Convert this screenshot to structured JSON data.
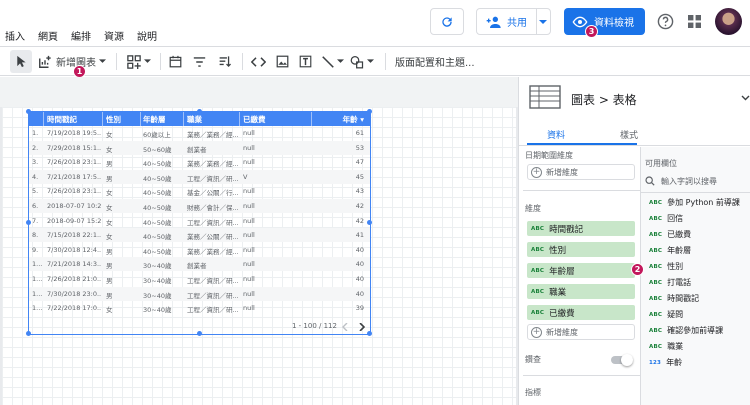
{
  "menu": [
    "插入",
    "網頁",
    "編排",
    "資源",
    "說明"
  ],
  "header": {
    "share_label": "共用",
    "view_label": "資料檢視",
    "view_badge": "3"
  },
  "toolbar": {
    "add_chart_label": "新增圖表",
    "add_chart_badge": "1",
    "theme_label": "版面配置和主題..."
  },
  "table": {
    "headers": [
      "時間戳記",
      "性別",
      "年齡層",
      "職業",
      "已繳費",
      "年齡 ▾"
    ],
    "rows": [
      [
        "1.",
        "7/19/2018 19:5...",
        "女",
        "60歲以上",
        "業務／業務／經...",
        "null",
        "61"
      ],
      [
        "2.",
        "7/29/2018 15:1...",
        "女",
        "50~60歲",
        "創業者",
        "null",
        "53"
      ],
      [
        "3.",
        "7/26/2018 23:1...",
        "男",
        "40~50歲",
        "業務／業務／經...",
        "null",
        "47"
      ],
      [
        "4.",
        "7/21/2018 17:5...",
        "男",
        "40~50歲",
        "工程／資訊／研...",
        "V",
        "45"
      ],
      [
        "5.",
        "7/26/2018 23:1...",
        "女",
        "40~50歲",
        "基金／公關／行...",
        "null",
        "43"
      ],
      [
        "6.",
        "2018-07-07 10:2...",
        "女",
        "40~50歲",
        "財務／會計／保...",
        "null",
        "42"
      ],
      [
        "7.",
        "2018-09-07 15:2...",
        "女",
        "40~50歲",
        "工程／資訊／研...",
        "null",
        "42"
      ],
      [
        "8.",
        "7/15/2018 22:1...",
        "女",
        "40~50歲",
        "業務／公關／研...",
        "null",
        "41"
      ],
      [
        "9.",
        "7/30/2018 12:4...",
        "男",
        "40~50歲",
        "業務／業務／經...",
        "null",
        "40"
      ],
      [
        "1...",
        "7/21/2018 14:3...",
        "男",
        "30~40歲",
        "創業者",
        "null",
        "40"
      ],
      [
        "1...",
        "7/26/2018 21:0...",
        "男",
        "30~40歲",
        "工程／資訊／研...",
        "null",
        "40"
      ],
      [
        "1...",
        "7/30/2018 23:0...",
        "男",
        "30~40歲",
        "工程／資訊／研...",
        "null",
        "40"
      ],
      [
        "1...",
        "7/22/2018 17:0...",
        "女",
        "30~40歲",
        "工程／資訊／研...",
        "null",
        "39"
      ]
    ],
    "pagination": "1 - 100 / 112"
  },
  "panel": {
    "title": "圖表 > 表格",
    "tab_data": "資料",
    "tab_style": "樣式",
    "date_range_label": "日期範圍維度",
    "add_dimension": "新增維度",
    "dimension_label": "維度",
    "dimensions": [
      "時間戳記",
      "性別",
      "年齡層",
      "職業",
      "已繳費"
    ],
    "drilldown_label": "鑽查",
    "metric_label": "指標",
    "available_label": "可用欄位",
    "search_placeholder": "輸入字詞以搜尋",
    "fields": [
      "參加 Python 前導課",
      "回信",
      "已繳費",
      "年齡層",
      "性別",
      "打電話",
      "時間戳記",
      "疑問",
      "確認參加前導課",
      "職業",
      "年齡"
    ],
    "drag_badge": "2",
    "abc_tag": "ABC",
    "num_tag": "123"
  },
  "colors": {
    "accent": "#1a73e8",
    "table_header": "#4285f4",
    "chip": "#c8e6c9",
    "badge": "#c2185b"
  }
}
